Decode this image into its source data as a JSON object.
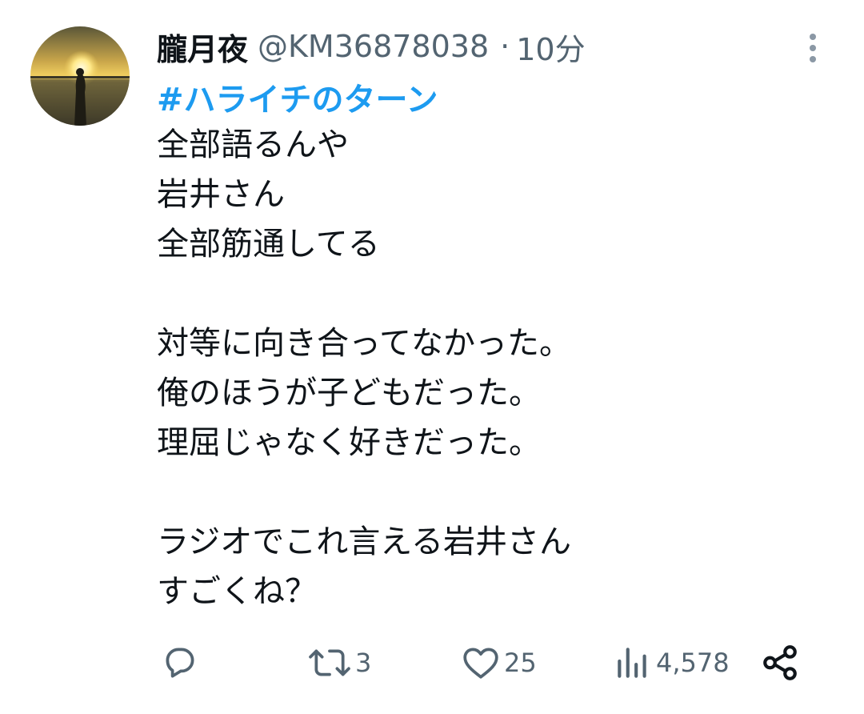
{
  "tweet": {
    "display_name": "朧月夜",
    "handle": "@KM36878038",
    "separator": "·",
    "time": "10分",
    "hashtag": "#ハライチのターン",
    "lines": [
      "全部語るんや",
      "岩井さん",
      "全部筋通してる",
      "",
      "対等に向き合ってなかった。",
      "俺のほうが子どもだった。",
      "理屈じゃなく好きだった。",
      "",
      "ラジオでこれ言える岩井さん",
      "すごくね？"
    ]
  },
  "actions": {
    "reply_icon": "reply-bubble-icon",
    "retweet_icon": "retweet-icon",
    "retweet_count": "3",
    "like_icon": "heart-icon",
    "like_count": "25",
    "views_icon": "bar-chart-icon",
    "views_count": "4,578",
    "share_icon": "share-icon"
  },
  "colors": {
    "text": "#0f1419",
    "secondary": "#536471",
    "link": "#1d9bf0"
  }
}
